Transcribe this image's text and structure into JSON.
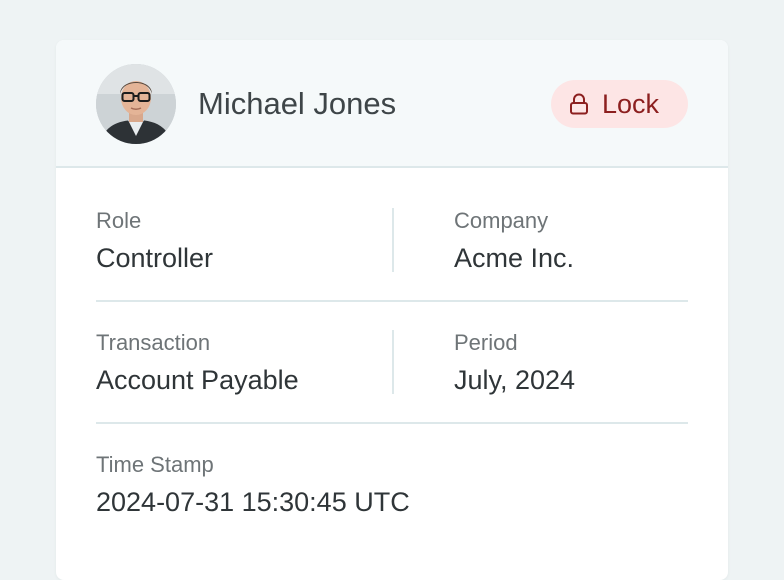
{
  "user": {
    "name": "Michael Jones",
    "avatar_icon": "person-photo"
  },
  "lock_button": {
    "label": "Lock",
    "icon": "lock-icon",
    "background": "#fde5e5",
    "color": "#8c1f1f"
  },
  "details": {
    "role": {
      "label": "Role",
      "value": "Controller"
    },
    "company": {
      "label": "Company",
      "value": "Acme Inc."
    },
    "transaction": {
      "label": "Transaction",
      "value": "Account Payable"
    },
    "period": {
      "label": "Period",
      "value": "July, 2024"
    },
    "timestamp": {
      "label": "Time Stamp",
      "value": "2024-07-31 15:30:45 UTC"
    }
  }
}
